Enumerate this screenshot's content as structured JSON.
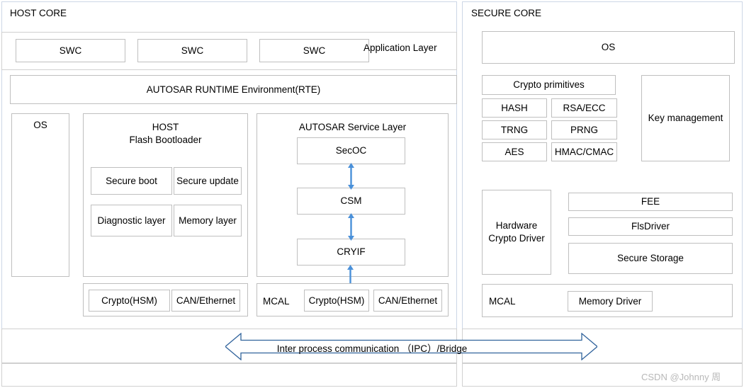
{
  "diagram": {
    "title_host": "HOST CORE",
    "title_secure": "SECURE CORE",
    "watermark": "CSDN @Johnny 周"
  },
  "host_core": {
    "application_layer": {
      "label": "Application Layer",
      "swc": [
        "SWC",
        "SWC",
        "SWC"
      ]
    },
    "rte": {
      "label": "AUTOSAR RUNTIME Environment(RTE)"
    },
    "os": {
      "label": "OS"
    },
    "bootloader": {
      "heading_line1": "HOST",
      "heading_line2": "Flash Bootloader",
      "items": [
        "Secure boot",
        "Secure update",
        "Diagnostic layer",
        "Memory layer"
      ]
    },
    "service_layer": {
      "heading": "AUTOSAR Service Layer",
      "stack": [
        "SecOC",
        "CSM",
        "CRYIF"
      ]
    },
    "driver_row_left": {
      "items": [
        "Crypto(HSM)",
        "CAN/Ethernet"
      ]
    },
    "mcal_row": {
      "label": "MCAL",
      "items": [
        "Crypto(HSM)",
        "CAN/Ethernet"
      ]
    }
  },
  "secure_core": {
    "os": {
      "label": "OS"
    },
    "crypto_primitives": {
      "heading": "Crypto primitives",
      "items": [
        "HASH",
        "RSA/ECC",
        "TRNG",
        "PRNG",
        "AES",
        "HMAC/CMAC"
      ]
    },
    "key_management": {
      "label": "Key management"
    },
    "hardware_crypto_driver": {
      "label": "Hardware Crypto Driver"
    },
    "memory_stack": {
      "items": [
        "FEE",
        "FlsDriver",
        "Secure Storage"
      ]
    },
    "mcal_row": {
      "label": "MCAL",
      "items": [
        "Memory Driver"
      ]
    }
  },
  "bridge": {
    "label": "Inter process communication （IPC）/Bridge"
  },
  "colors": {
    "arrow_blue": "#4a90d9",
    "bridge_outline": "#31639c",
    "core_border": "#ccd6e6",
    "box_border": "#bfbfbf"
  }
}
